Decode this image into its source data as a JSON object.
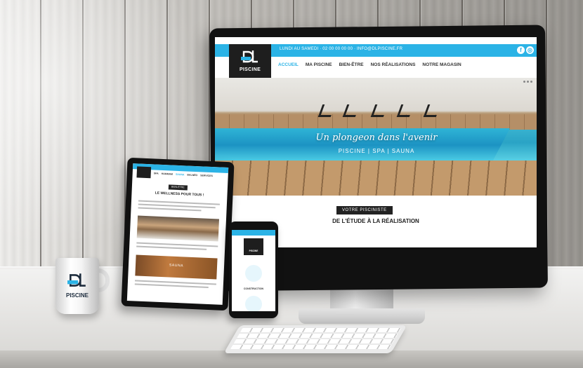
{
  "colors": {
    "accent": "#2bb3e6",
    "dark": "#1e1e1e"
  },
  "brand": {
    "logo_text": "PISCINE",
    "mug_text": "PISCINE"
  },
  "site": {
    "topbar": {
      "info": "LUNDI AU SAMEDI · 02 00 00 00 00 · INFO@DLPISCINE.FR",
      "facebook": "f",
      "instagram": "◎"
    },
    "nav": [
      {
        "label": "ACCUEIL",
        "active": true
      },
      {
        "label": "MA PISCINE",
        "active": false
      },
      {
        "label": "BIEN-ÊTRE",
        "active": false
      },
      {
        "label": "NOS RÉALISATIONS",
        "active": false
      },
      {
        "label": "NOTRE MAGASIN",
        "active": false
      }
    ],
    "hero": {
      "title": "Un plongeon dans l'avenir",
      "subtitle": "PISCINE | SPA | SAUNA"
    },
    "section": {
      "badge": "VOTRE PISCINISTE",
      "title": "DE L'ÉTUDE À LA RÉALISATION"
    }
  },
  "tablet": {
    "nav": [
      "SPA",
      "HAMMAM",
      "SAUNA",
      "BALNÉO",
      "SERVICES"
    ],
    "badge": "BIEN-ÊTRE",
    "title": "LE WELLNESS POUR TOUS !",
    "image_label": "SAUNA"
  },
  "phone": {
    "logo_text": "PISCINE",
    "section_head": "CONSTRUCTION"
  }
}
